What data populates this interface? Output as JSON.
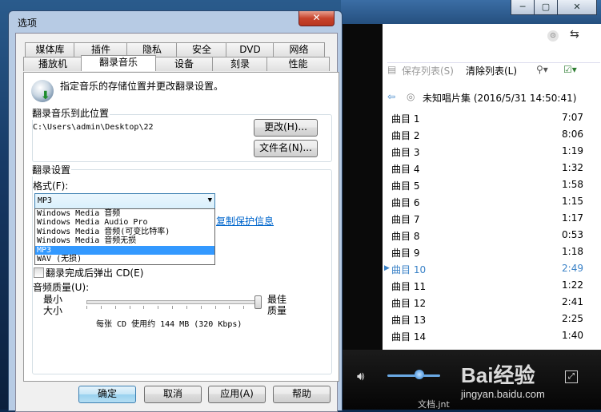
{
  "player": {
    "toolbar": {
      "save_list": "保存列表(S)",
      "clear_list": "清除列表(L)"
    },
    "album": "未知唱片集 (2016/5/31 14:50:41)",
    "tracks": [
      {
        "name": "曲目 1",
        "time": "7:07"
      },
      {
        "name": "曲目 2",
        "time": "8:06"
      },
      {
        "name": "曲目 3",
        "time": "1:19"
      },
      {
        "name": "曲目 4",
        "time": "1:32"
      },
      {
        "name": "曲目 5",
        "time": "1:58"
      },
      {
        "name": "曲目 6",
        "time": "1:15"
      },
      {
        "name": "曲目 7",
        "time": "1:17"
      },
      {
        "name": "曲目 8",
        "time": "0:53"
      },
      {
        "name": "曲目 9",
        "time": "1:18"
      },
      {
        "name": "曲目 10",
        "time": "2:49",
        "current": true
      },
      {
        "name": "曲目 11",
        "time": "1:22"
      },
      {
        "name": "曲目 12",
        "time": "2:41"
      },
      {
        "name": "曲目 13",
        "time": "2:25"
      },
      {
        "name": "曲目 14",
        "time": "1:40"
      }
    ],
    "volume_level": 0.6,
    "watermark": {
      "brand": "Bai经验",
      "url": "jingyan.baidu.com"
    },
    "bottom_text": "文档.jnt"
  },
  "dialog": {
    "title": "选项",
    "close_label": "✕",
    "tabs_row1": [
      "媒体库",
      "插件",
      "隐私",
      "安全",
      "DVD",
      "网络"
    ],
    "tabs_row2": [
      "播放机",
      "翻录音乐",
      "设备",
      "刻录",
      "性能"
    ],
    "selected_tab": "翻录音乐",
    "header_text": "指定音乐的存储位置并更改翻录设置。",
    "rip_location": {
      "group_title": "翻录音乐到此位置",
      "path": "C:\\Users\\admin\\Desktop\\22",
      "change_button": "更改(H)...",
      "filename_button": "文件名(N)..."
    },
    "rip_settings": {
      "group_title": "翻录设置",
      "format_label": "格式(F):",
      "format_value": "MP3",
      "format_options": [
        "Windows Media 音频",
        "Windows Media Audio Pro",
        "Windows Media 音频(可变比特率)",
        "Windows Media 音频无损",
        "MP3",
        "WAV (无损)"
      ],
      "selected_option": "MP3",
      "copy_protect_link": "复制保护信息",
      "eject_label": "翻录完成后弹出 CD(E)",
      "eject_checked": false,
      "quality_label": "音频质量(U):",
      "min_label": [
        "最小",
        "大小"
      ],
      "max_label": [
        "最佳",
        "质量"
      ],
      "quality_level": 1.0,
      "quality_info": "每张 CD 使用约 144 MB (320 Kbps)"
    },
    "buttons": {
      "ok": "确定",
      "cancel": "取消",
      "apply": "应用(A)",
      "help": "帮助"
    }
  },
  "colors": {
    "accent": "#3399ff",
    "link": "#0066cc",
    "current_track": "#3a82c7"
  }
}
